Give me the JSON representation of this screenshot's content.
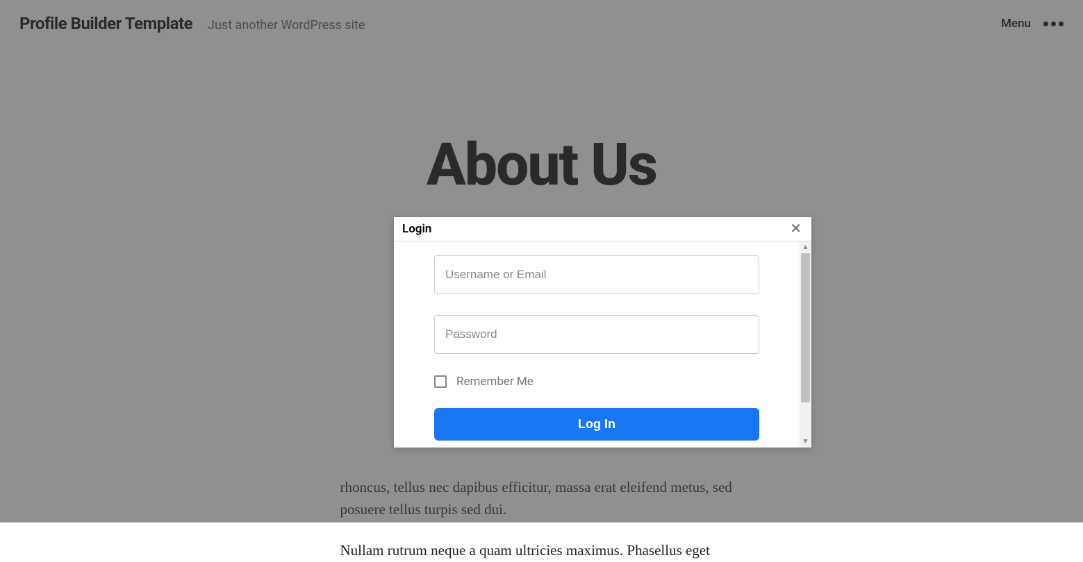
{
  "header": {
    "site_title": "Profile Builder Template",
    "site_tagline": "Just another WordPress site",
    "menu_label": "Menu"
  },
  "page": {
    "heading": "About Us",
    "paragraphs": [
      "rhoncus, tellus nec dapibus efficitur, massa erat eleifend metus, sed posuere tellus turpis sed dui.",
      "Nullam rutrum neque a quam ultricies maximus. Phasellus eget"
    ]
  },
  "modal": {
    "title": "Login",
    "close_glyph": "✕",
    "username_placeholder": "Username or Email",
    "password_placeholder": "Password",
    "remember_label": "Remember Me",
    "submit_label": "Log In"
  }
}
